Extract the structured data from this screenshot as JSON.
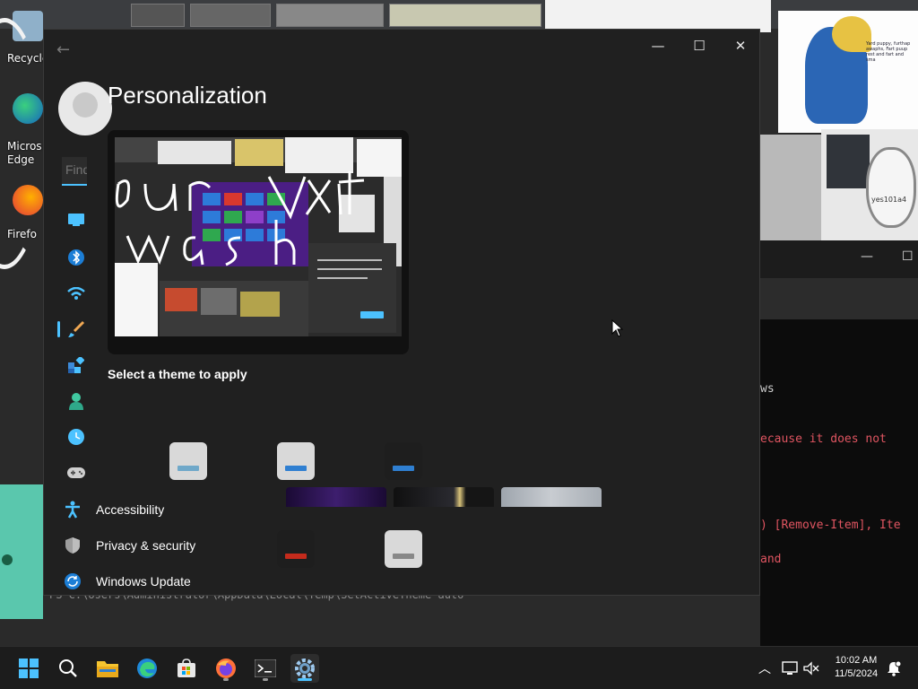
{
  "window": {
    "title": "Personalization",
    "controls": {
      "minimize": "—",
      "maximize": "☐",
      "close": "✕"
    }
  },
  "search": {
    "placeholder": "Find a setting",
    "value": ""
  },
  "nav": {
    "icons": [
      {
        "name": "system",
        "color": "#4cc2ff"
      },
      {
        "name": "bluetooth",
        "color": "#4cc2ff"
      },
      {
        "name": "network",
        "color": "#4cc2ff"
      },
      {
        "name": "personalization",
        "color": "#f0a854",
        "active": true
      },
      {
        "name": "apps",
        "color": "#4cc2ff"
      },
      {
        "name": "accounts",
        "color": "#40c8a0"
      },
      {
        "name": "time-language",
        "color": "#4cc2ff"
      },
      {
        "name": "gaming",
        "color": "#cccccc"
      }
    ],
    "items": [
      {
        "label": "Accessibility"
      },
      {
        "label": "Privacy & security"
      },
      {
        "label": "Windows Update"
      }
    ]
  },
  "main": {
    "section_label": "Select a theme to apply"
  },
  "themes": [
    {
      "name": "light-theme-1",
      "bg": "#d9d9d9",
      "bar": "#6fa8c9"
    },
    {
      "name": "light-theme-2",
      "bg": "#d9d9d9",
      "bar": "#2f7fd1"
    },
    {
      "name": "dark-theme-1",
      "bg": "#1e1e1e",
      "bar": "#2f7fd1"
    },
    {
      "name": "glow-theme",
      "bg": "#2a1540",
      "bar": ""
    },
    {
      "name": "captured-motion-theme",
      "bg": "#141414",
      "bar": ""
    },
    {
      "name": "flow-theme",
      "bg": "#b7bcc2",
      "bar": ""
    },
    {
      "name": "dark-theme-red",
      "bg": "#1e1e1e",
      "bar": "#c42b1c"
    },
    {
      "name": "light-theme-3",
      "bg": "#d9d9d9",
      "bar": "#888888"
    }
  ],
  "desktop": {
    "icons": [
      {
        "label": "Recycle"
      },
      {
        "label": "Micros Edge"
      },
      {
        "label": "Firefo"
      }
    ],
    "cartoon_text": "Yard puppy, furthap awaphs, Fart puup rest and fart and sma",
    "mini_label": "yes101a4"
  },
  "terminal": {
    "lines": [
      {
        "text": "ws",
        "color": "gray"
      },
      {
        "text": "ecause it does not",
        "color": "red"
      },
      {
        "text": ") [Remove-Item], Ite",
        "color": "red"
      },
      {
        "text": "and",
        "color": "red"
      }
    ],
    "bottom_line": "PS C:\\Users\\Administrator\\AppData\\Local\\Temp\\SetActiveTheme-auto"
  },
  "taskbar": {
    "apps": [
      {
        "name": "start",
        "active": false
      },
      {
        "name": "search",
        "active": false
      },
      {
        "name": "file-explorer",
        "active": false
      },
      {
        "name": "edge",
        "active": false
      },
      {
        "name": "store",
        "active": false
      },
      {
        "name": "firefox",
        "active": false,
        "running": true
      },
      {
        "name": "terminal",
        "active": false,
        "running": true
      },
      {
        "name": "settings",
        "active": true,
        "running": true
      }
    ],
    "time": "10:02 AM",
    "date": "11/5/2024"
  }
}
